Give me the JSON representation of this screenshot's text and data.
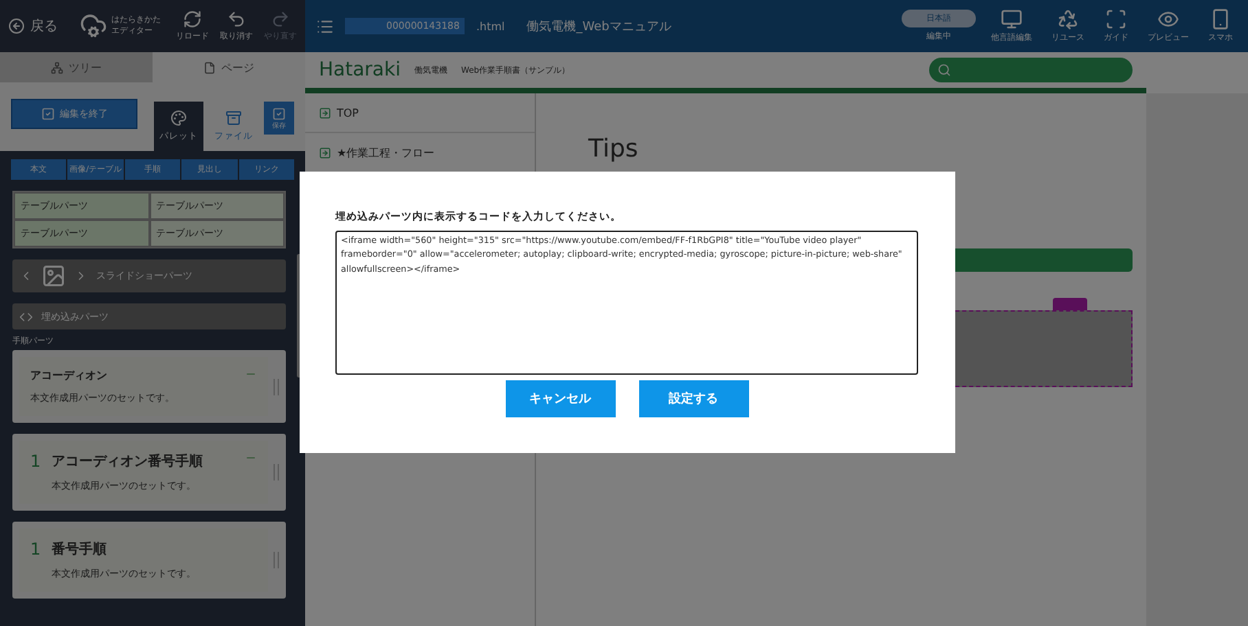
{
  "toolbar": {
    "back": "戻る",
    "logo_lines": [
      "はたらきかた",
      "エディター"
    ],
    "actions": [
      {
        "kind": "reload",
        "label": "リロード",
        "disabled": false
      },
      {
        "kind": "undo",
        "label": "取り消す",
        "disabled": false
      },
      {
        "kind": "redo",
        "label": "やり直す",
        "disabled": true
      }
    ]
  },
  "header": {
    "file_id": "000000143188",
    "extension": ".html",
    "title": "働気電機_Webマニュアル",
    "language": "日本語",
    "status": "編集中",
    "actions": [
      {
        "kind": "globe",
        "label": "他言語編集"
      },
      {
        "kind": "reuse",
        "label": "リユース"
      },
      {
        "kind": "guide",
        "label": "ガイド"
      },
      {
        "kind": "preview",
        "label": "プレビュー"
      },
      {
        "kind": "phone",
        "label": "スマホ"
      }
    ]
  },
  "left_tabs": [
    {
      "kind": "tree",
      "label": "ツリー",
      "selected": false
    },
    {
      "kind": "page",
      "label": "ページ",
      "selected": true
    }
  ],
  "finish_button": "編集を終了",
  "panel_tabs": [
    {
      "kind": "palette",
      "label": "パレット",
      "selected": true
    },
    {
      "kind": "file",
      "label": "ファイル",
      "selected": false
    }
  ],
  "save_button": "保存",
  "categories": [
    "本文",
    "画像/テーブル",
    "手順",
    "見出し",
    "リンク"
  ],
  "table_part": [
    "テーブルパーツ",
    "テーブルパーツ",
    "テーブルパーツ",
    "テーブルパーツ"
  ],
  "slideshow_part": "スライドショーパーツ",
  "embed_part": "埋め込みパーツ",
  "section_label": "手順パーツ",
  "step_parts": [
    {
      "kind": "accordion",
      "title": "アコーディオン",
      "description": "本文作成用パーツのセットです。",
      "collapsible": true
    },
    {
      "kind": "numbered",
      "number": "1",
      "title": "アコーディオン番号手順",
      "description": "本文作成用パーツのセットです。",
      "collapsible": true
    },
    {
      "kind": "numbered",
      "number": "1",
      "title": "番号手順",
      "description": "本文作成用パーツのセットです。",
      "collapsible": false
    }
  ],
  "site": {
    "logo": "Hataraki",
    "brand": "働気電機",
    "subtitle": "Web作業手順書（サンプル）"
  },
  "nav": [
    "TOP",
    "★作業工程・フロー"
  ],
  "content_heading": "Tips",
  "dialog": {
    "prompt": "埋め込みパーツ内に表示するコードを入力してください。",
    "code": "<iframe width=\"560\" height=\"315\" src=\"https://www.youtube.com/embed/FF-f1RbGPI8\" title=\"YouTube video player\" frameborder=\"0\" allow=\"accelerometer; autoplay; clipboard-write; encrypted-media; gyroscope; picture-in-picture; web-share\" allowfullscreen></iframe>",
    "buttons": [
      "キャンセル",
      "設定する"
    ]
  }
}
